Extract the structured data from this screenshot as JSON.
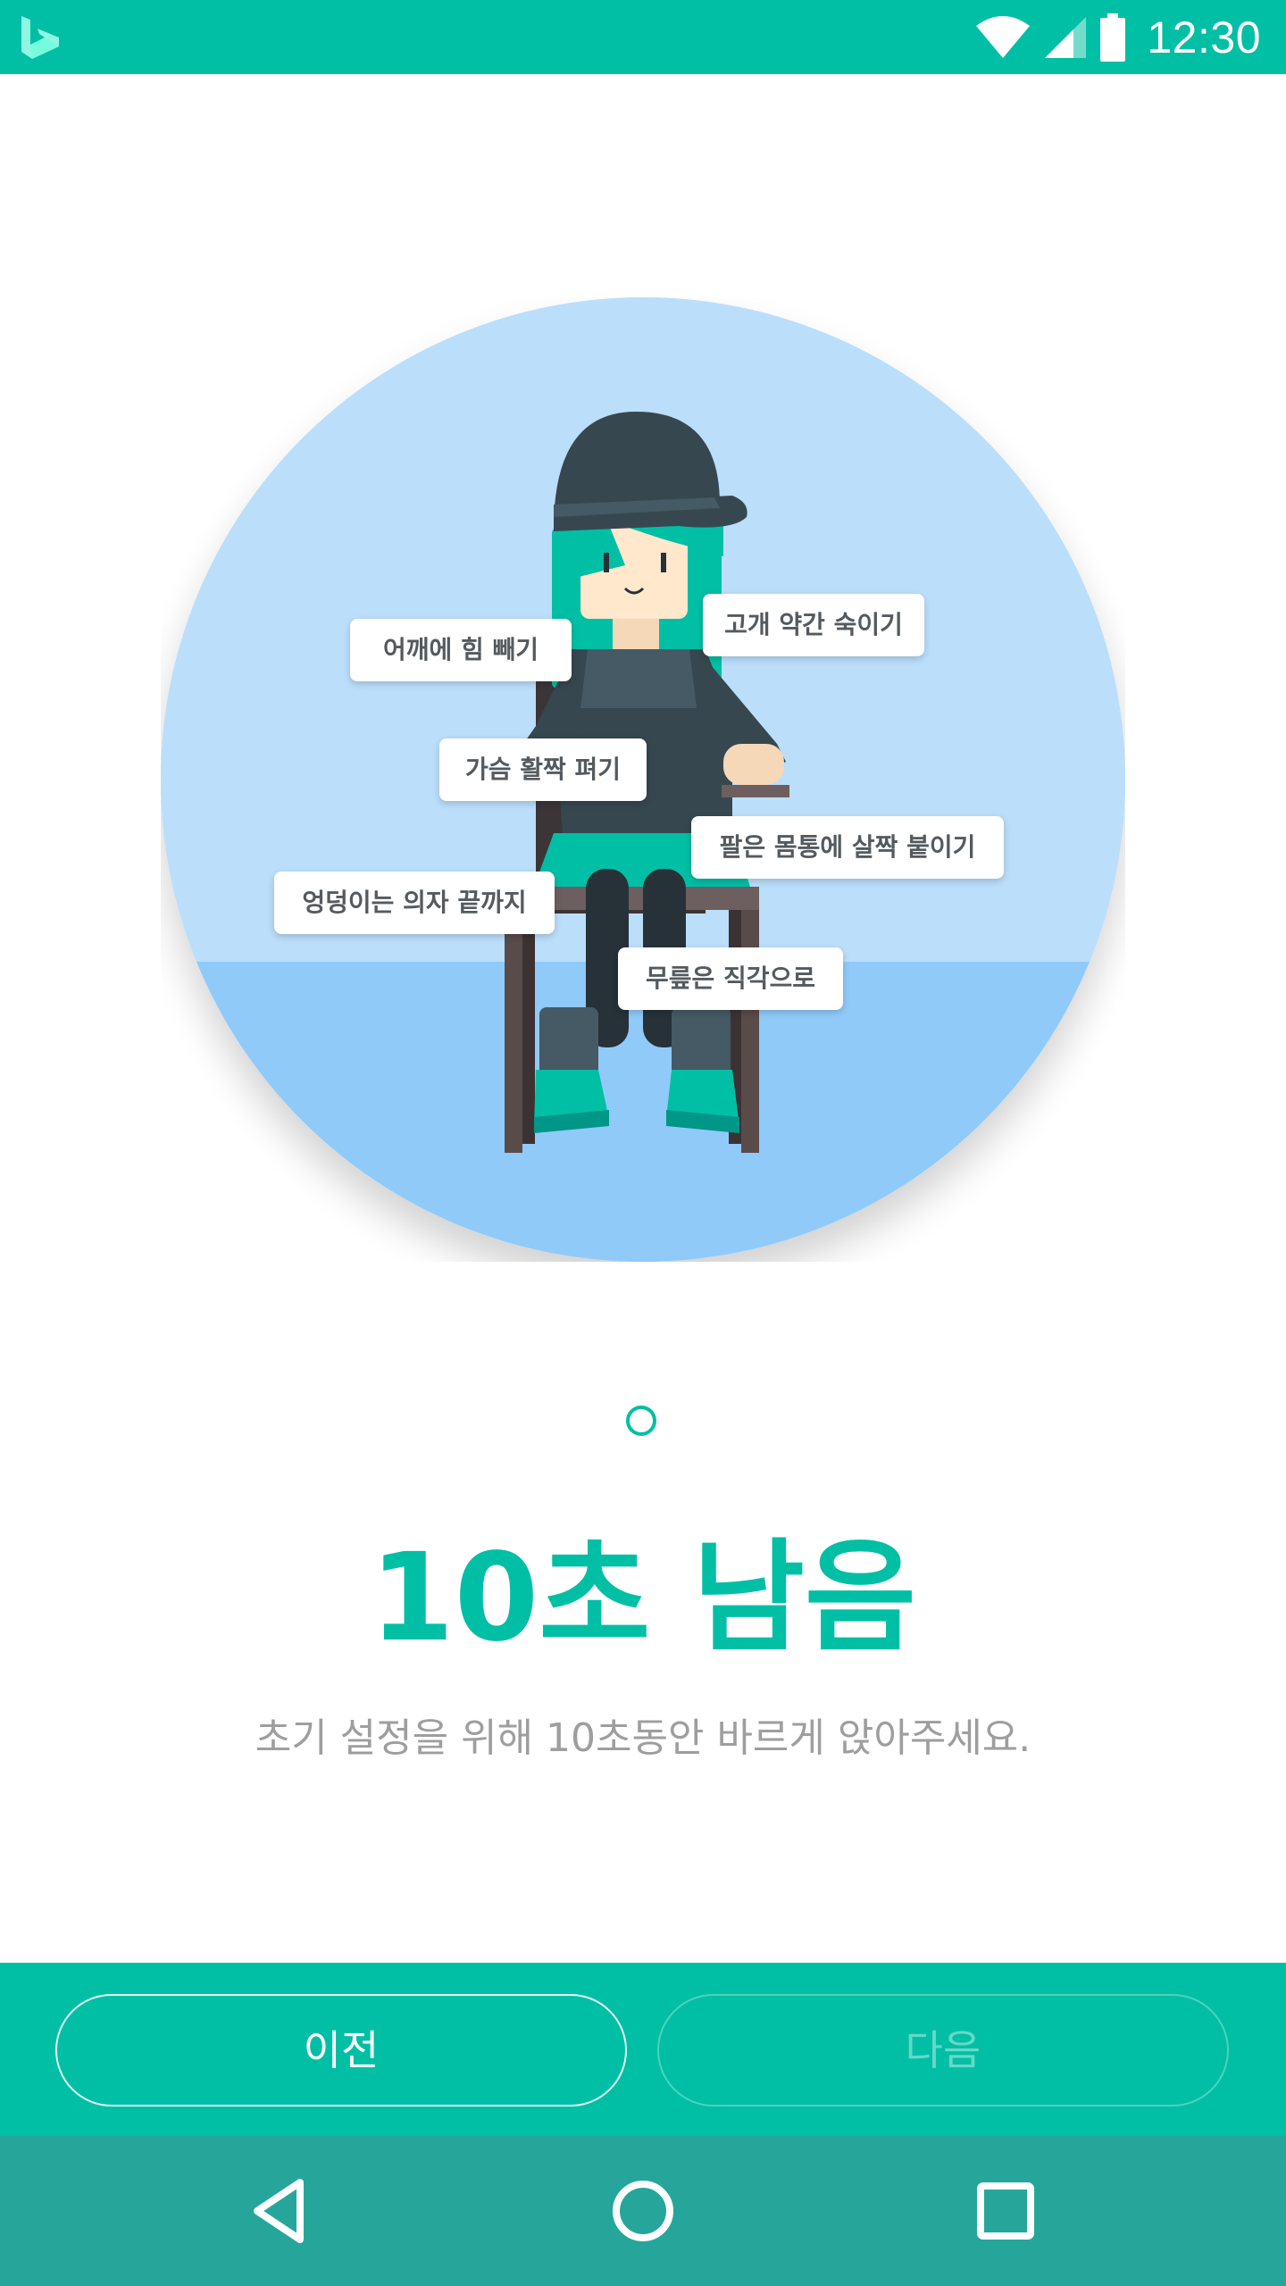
{
  "status_bar": {
    "time": "12:30",
    "icons": [
      "bing-logo-icon",
      "wifi-icon",
      "signal-icon",
      "battery-icon"
    ]
  },
  "posture_tips": [
    "어깨에 힘 빼기",
    "고개 약간 숙이기",
    "가슴 활짝 펴기",
    "팔은 몸통에 살짝 붙이기",
    "엉덩이는 의자 끝까지",
    "무릎은 직각으로"
  ],
  "pager": {
    "current": 1,
    "total": 1
  },
  "countdown": {
    "title": "10초 남음",
    "instruction": "초기 설정을 위해 10초동안 바르게 앉아주세요."
  },
  "buttons": {
    "prev_label": "이전",
    "next_label": "다음"
  },
  "nav_bar": {
    "icons": [
      "back-icon",
      "home-icon",
      "recents-icon"
    ]
  },
  "colors": {
    "accent": "#00bfa5",
    "nav_bar": "#26a69a",
    "sky": "#bbdefb",
    "floor": "#90caf9",
    "instruction_text": "#9e9e9e",
    "tip_text": "#555a5e"
  }
}
